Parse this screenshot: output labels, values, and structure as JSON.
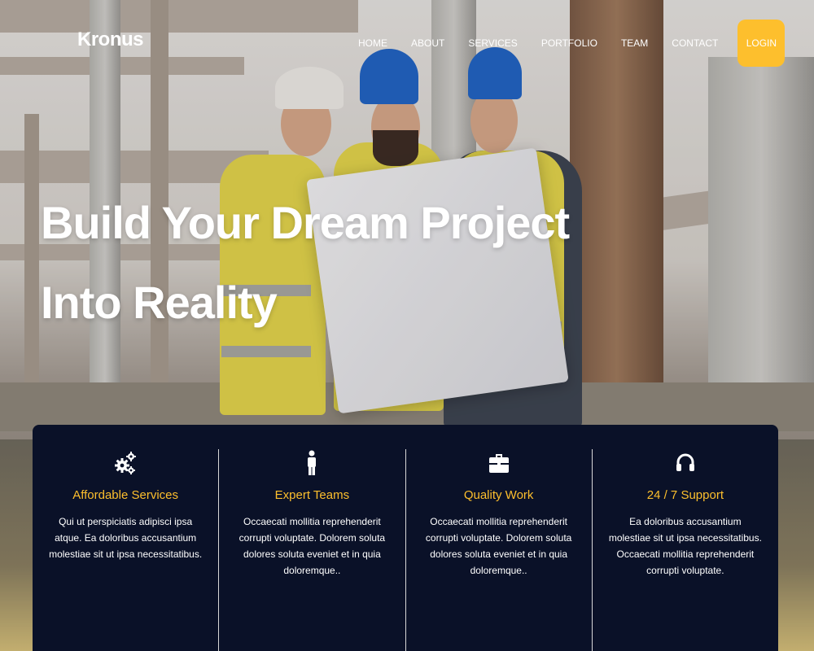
{
  "brand": "Kronus",
  "nav": {
    "items": [
      "HOME",
      "ABOUT",
      "SERVICES",
      "PORTFOLIO",
      "TEAM",
      "CONTACT"
    ],
    "login_label": "LOGIN"
  },
  "hero": {
    "headline_line1": "Build Your Dream Project",
    "headline_line2": "Into Reality"
  },
  "features": [
    {
      "icon": "gears-icon",
      "title": "Affordable Services",
      "text": "Qui ut perspiciatis adipisci ipsa atque. Ea doloribus accusantium molestiae sit ut ipsa necessitatibus."
    },
    {
      "icon": "person-icon",
      "title": "Expert Teams",
      "text": "Occaecati mollitia reprehenderit corrupti voluptate. Dolorem soluta dolores soluta eveniet et in quia doloremque.."
    },
    {
      "icon": "briefcase-icon",
      "title": "Quality Work",
      "text": "Occaecati mollitia reprehenderit corrupti voluptate. Dolorem soluta dolores soluta eveniet et in quia doloremque.."
    },
    {
      "icon": "headset-icon",
      "title": "24 / 7 Support",
      "text": "Ea doloribus accusantium molestiae sit ut ipsa necessitatibus. Occaecati mollitia reprehenderit corrupti voluptate."
    }
  ],
  "colors": {
    "accent": "#fdbf2d",
    "panel": "#0a1128"
  }
}
